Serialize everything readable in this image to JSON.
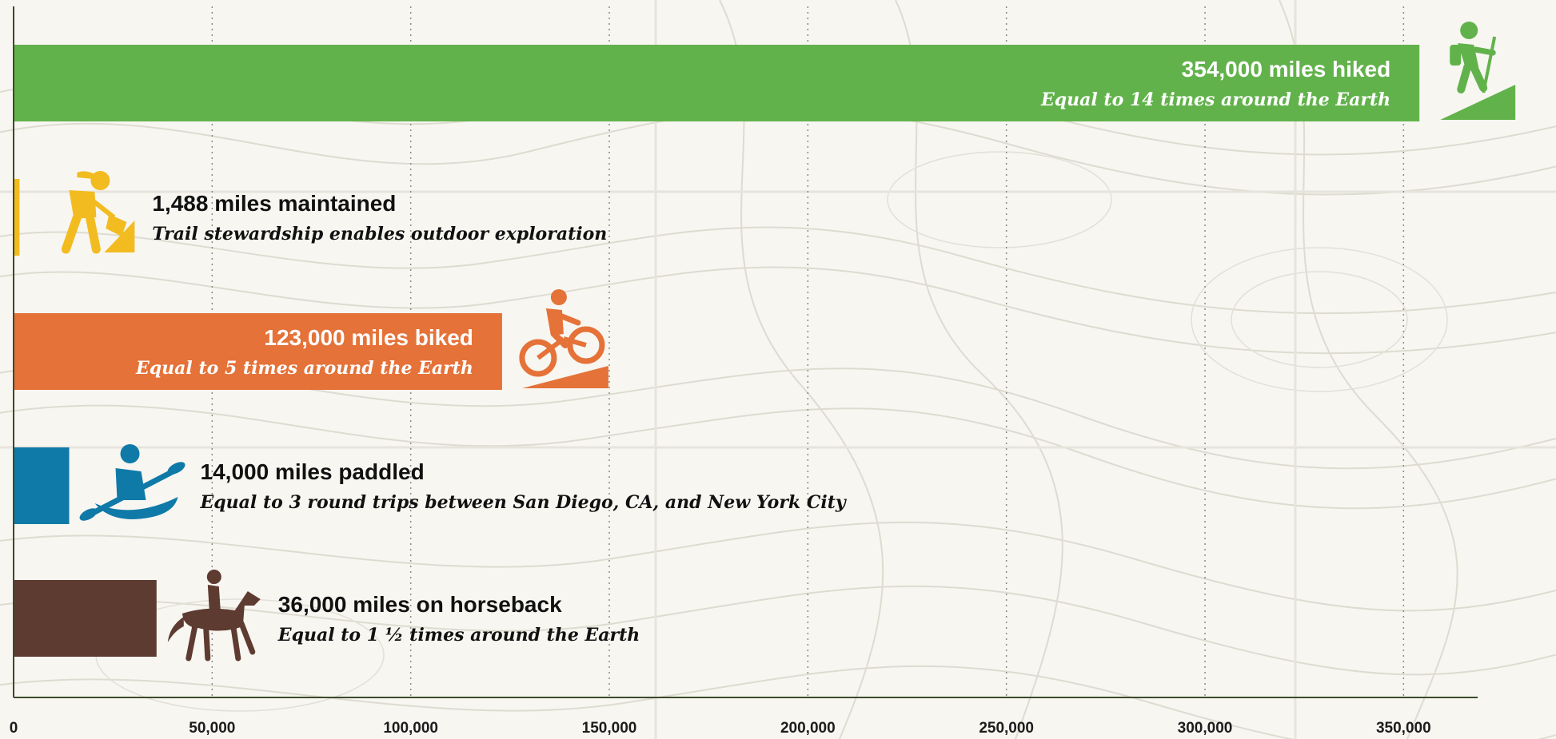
{
  "chart_data": {
    "type": "bar",
    "orientation": "horizontal",
    "categories": [
      "hiked",
      "maintained",
      "biked",
      "paddled",
      "on horseback"
    ],
    "values": [
      354000,
      1488,
      123000,
      14000,
      36000
    ],
    "xlim": [
      0,
      360000
    ],
    "x_ticks": [
      0,
      50000,
      100000,
      150000,
      200000,
      250000,
      300000,
      350000
    ],
    "x_tick_labels": [
      "0",
      "50,000",
      "100,000",
      "150,000",
      "200,000",
      "250,000",
      "300,000",
      "350,000"
    ],
    "grid": "vertical dotted",
    "bars": [
      {
        "value": 354000,
        "label": "354,000 miles hiked",
        "sublabel": "Equal to 14 times around the Earth",
        "color": "#62b24b",
        "icon": "hiker-icon",
        "label_position": "inside"
      },
      {
        "value": 1488,
        "label": "1,488 miles maintained",
        "sublabel": "Trail stewardship enables outdoor exploration",
        "color": "#f2bc20",
        "icon": "trail-worker-icon",
        "label_position": "outside"
      },
      {
        "value": 123000,
        "label": "123,000 miles biked",
        "sublabel": "Equal to 5 times around the Earth",
        "color": "#e57238",
        "icon": "mountain-biker-icon",
        "label_position": "inside"
      },
      {
        "value": 14000,
        "label": "14,000 miles paddled",
        "sublabel": "Equal to 3 round trips between San Diego, CA, and New York City",
        "color": "#0f7aa8",
        "icon": "kayaker-icon",
        "label_position": "outside"
      },
      {
        "value": 36000,
        "label": "36,000 miles on horseback",
        "sublabel": "Equal to 1 ½ times around the Earth",
        "color": "#5e3b31",
        "icon": "horse-rider-icon",
        "label_position": "outside"
      }
    ]
  },
  "colors": {
    "axis": "#3d4a2a",
    "grid": "#8a8a8a",
    "label_dark": "#111111",
    "label_light": "#ffffff",
    "background": "#f7f6f1"
  }
}
